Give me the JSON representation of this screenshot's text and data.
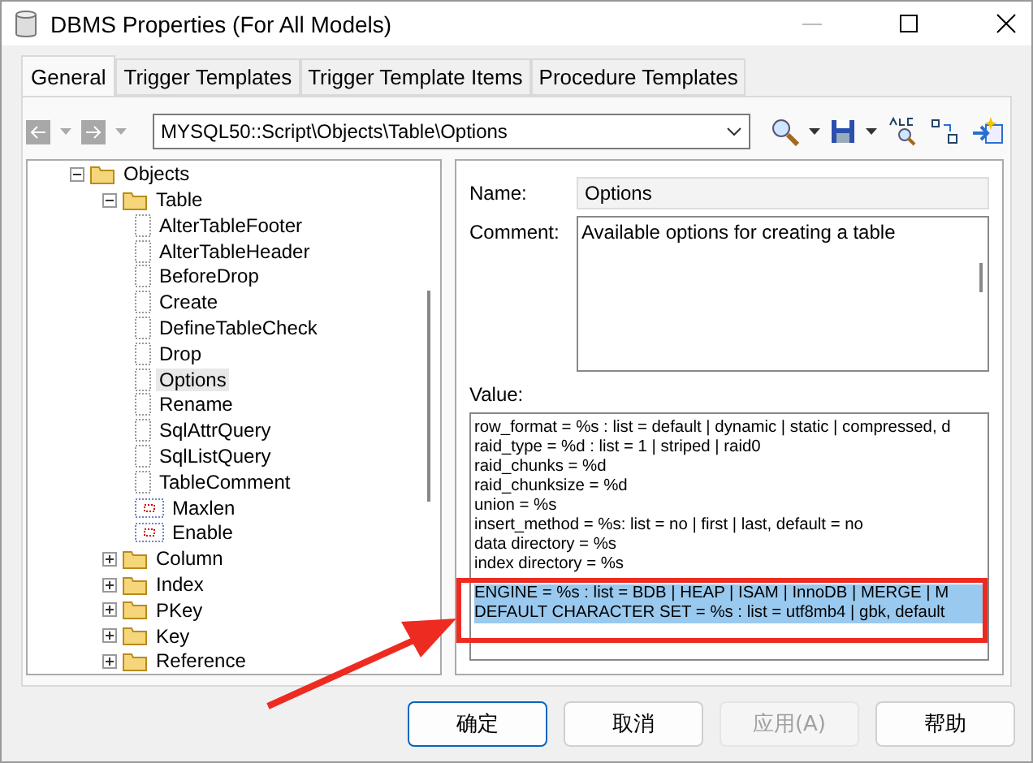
{
  "window": {
    "title": "DBMS Properties (For All Models)"
  },
  "tabs": [
    {
      "label": "General",
      "selected": true
    },
    {
      "label": "Trigger Templates",
      "selected": false
    },
    {
      "label": "Trigger Template Items",
      "selected": false
    },
    {
      "label": "Procedure Templates",
      "selected": false
    }
  ],
  "toolbar": {
    "back_enabled": false,
    "forward_enabled": false,
    "path": "MYSQL50::Script\\Objects\\Table\\Options"
  },
  "tree": [
    {
      "label": "Objects",
      "kind": "folder",
      "expanded": true,
      "selected": false,
      "children": [
        {
          "label": "Table",
          "kind": "folder",
          "expanded": true,
          "selected": false,
          "children": [
            {
              "label": "AlterTableFooter",
              "kind": "script",
              "selected": false
            },
            {
              "label": "AlterTableHeader",
              "kind": "script",
              "selected": false
            },
            {
              "label": "BeforeDrop",
              "kind": "script",
              "selected": false
            },
            {
              "label": "Create",
              "kind": "script",
              "selected": false
            },
            {
              "label": "DefineTableCheck",
              "kind": "script",
              "selected": false
            },
            {
              "label": "Drop",
              "kind": "script",
              "selected": false
            },
            {
              "label": "Options",
              "kind": "script",
              "selected": true
            },
            {
              "label": "Rename",
              "kind": "script",
              "selected": false
            },
            {
              "label": "SqlAttrQuery",
              "kind": "script",
              "selected": false
            },
            {
              "label": "SqlListQuery",
              "kind": "script",
              "selected": false
            },
            {
              "label": "TableComment",
              "kind": "script",
              "selected": false
            },
            {
              "label": "Maxlen",
              "kind": "variable",
              "selected": false
            },
            {
              "label": "Enable",
              "kind": "variable",
              "selected": false
            }
          ]
        },
        {
          "label": "Column",
          "kind": "folder",
          "expanded": false,
          "selected": false
        },
        {
          "label": "Index",
          "kind": "folder",
          "expanded": false,
          "selected": false
        },
        {
          "label": "PKey",
          "kind": "folder",
          "expanded": false,
          "selected": false
        },
        {
          "label": "Key",
          "kind": "folder",
          "expanded": false,
          "selected": false
        },
        {
          "label": "Reference",
          "kind": "folder",
          "expanded": false,
          "selected": false
        }
      ]
    }
  ],
  "name": {
    "label": "Name:",
    "value": "Options"
  },
  "comment": {
    "label": "Comment:",
    "value": "Available options for creating a table"
  },
  "value": {
    "label": "Value:",
    "lines": [
      {
        "text": "row_format = %s : list = default | dynamic | static | compressed, d",
        "selected": false
      },
      {
        "text": "raid_type = %d : list = 1 | striped | raid0",
        "selected": false
      },
      {
        "text": "raid_chunks = %d",
        "selected": false
      },
      {
        "text": "raid_chunksize = %d",
        "selected": false
      },
      {
        "text": "union = %s",
        "selected": false
      },
      {
        "text": "insert_method = %s: list = no | first | last, default = no",
        "selected": false
      },
      {
        "text": "data directory = %s",
        "selected": false
      },
      {
        "text": "index directory = %s",
        "selected": false
      },
      {
        "text": "ENGINE = %s : list = BDB | HEAP | ISAM | InnoDB | MERGE | M",
        "selected": true
      },
      {
        "text": "DEFAULT CHARACTER SET = %s : list = utf8mb4 | gbk, default",
        "selected": true
      }
    ]
  },
  "buttons": [
    {
      "label": "确定",
      "default": true,
      "disabled": false
    },
    {
      "label": "取消",
      "default": false,
      "disabled": false
    },
    {
      "label": "应用(A)",
      "default": false,
      "disabled": true
    },
    {
      "label": "帮助",
      "default": false,
      "disabled": false
    }
  ]
}
